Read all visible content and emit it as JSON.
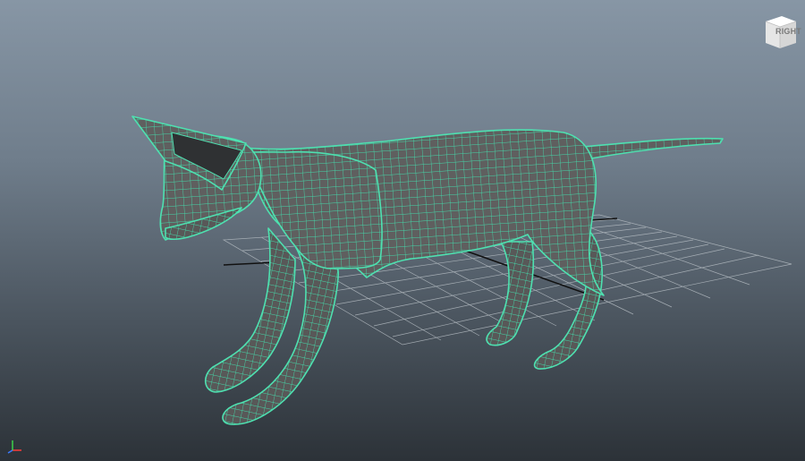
{
  "viewport": {
    "view_cube_label": "RIGHT",
    "background_top": "#8796a5",
    "background_bottom": "#2c3238"
  },
  "model": {
    "wire_color": "#4ee0b0",
    "surface_color": "#5c5c5c",
    "icon": "cat-mesh"
  },
  "axis_indicator": {
    "icon": "xyz-axis-icon",
    "x_color": "#ff3b3b",
    "y_color": "#3bd14a",
    "z_color": "#3b7bff"
  }
}
